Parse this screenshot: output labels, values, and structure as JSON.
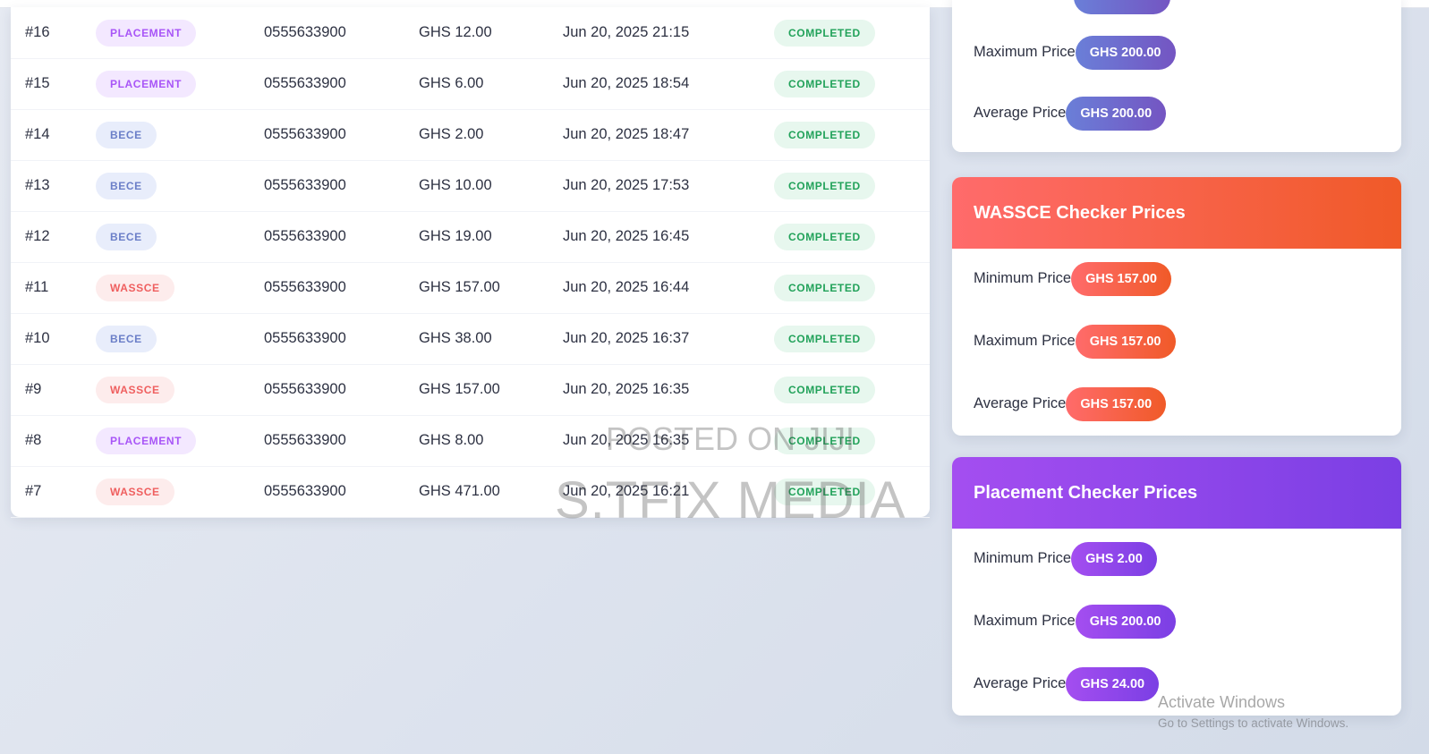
{
  "orders": [
    {
      "id": "#16",
      "type": "PLACEMENT",
      "type_key": "placement",
      "phone": "0555633900",
      "amount": "GHS 12.00",
      "date": "Jun 20, 2025 21:15",
      "status": "COMPLETED"
    },
    {
      "id": "#15",
      "type": "PLACEMENT",
      "type_key": "placement",
      "phone": "0555633900",
      "amount": "GHS 6.00",
      "date": "Jun 20, 2025 18:54",
      "status": "COMPLETED"
    },
    {
      "id": "#14",
      "type": "BECE",
      "type_key": "bece",
      "phone": "0555633900",
      "amount": "GHS 2.00",
      "date": "Jun 20, 2025 18:47",
      "status": "COMPLETED"
    },
    {
      "id": "#13",
      "type": "BECE",
      "type_key": "bece",
      "phone": "0555633900",
      "amount": "GHS 10.00",
      "date": "Jun 20, 2025 17:53",
      "status": "COMPLETED"
    },
    {
      "id": "#12",
      "type": "BECE",
      "type_key": "bece",
      "phone": "0555633900",
      "amount": "GHS 19.00",
      "date": "Jun 20, 2025 16:45",
      "status": "COMPLETED"
    },
    {
      "id": "#11",
      "type": "WASSCE",
      "type_key": "wassce",
      "phone": "0555633900",
      "amount": "GHS 157.00",
      "date": "Jun 20, 2025 16:44",
      "status": "COMPLETED"
    },
    {
      "id": "#10",
      "type": "BECE",
      "type_key": "bece",
      "phone": "0555633900",
      "amount": "GHS 38.00",
      "date": "Jun 20, 2025 16:37",
      "status": "COMPLETED"
    },
    {
      "id": "#9",
      "type": "WASSCE",
      "type_key": "wassce",
      "phone": "0555633900",
      "amount": "GHS 157.00",
      "date": "Jun 20, 2025 16:35",
      "status": "COMPLETED"
    },
    {
      "id": "#8",
      "type": "PLACEMENT",
      "type_key": "placement",
      "phone": "0555633900",
      "amount": "GHS 8.00",
      "date": "Jun 20, 2025 16:35",
      "status": "COMPLETED"
    },
    {
      "id": "#7",
      "type": "WASSCE",
      "type_key": "wassce",
      "phone": "0555633900",
      "amount": "GHS 471.00",
      "date": "Jun 20, 2025 16:21",
      "status": "COMPLETED"
    }
  ],
  "bece_prices": {
    "max_label": "Maximum Price",
    "max_value": "GHS 200.00",
    "avg_label": "Average Price",
    "avg_value": "GHS 200.00"
  },
  "wassce_prices": {
    "title": "WASSCE Checker Prices",
    "min_label": "Minimum Price",
    "min_value": "GHS 157.00",
    "max_label": "Maximum Price",
    "max_value": "GHS 157.00",
    "avg_label": "Average Price",
    "avg_value": "GHS 157.00"
  },
  "placement_prices": {
    "title": "Placement Checker Prices",
    "min_label": "Minimum Price",
    "min_value": "GHS 2.00",
    "max_label": "Maximum Price",
    "max_value": "GHS 200.00",
    "avg_label": "Average Price",
    "avg_value": "GHS 24.00"
  },
  "watermark": {
    "line1": "POSTED ON JIJI",
    "line2": "S.TFIX MEDIA"
  },
  "windows_notice": {
    "title": "Activate Windows",
    "subtitle": "Go to Settings to activate Windows."
  },
  "colors": {
    "placement": "#a855f7",
    "bece": "#6b7fc8",
    "wassce": "#ef5f5f",
    "completed": "#22a25a"
  }
}
